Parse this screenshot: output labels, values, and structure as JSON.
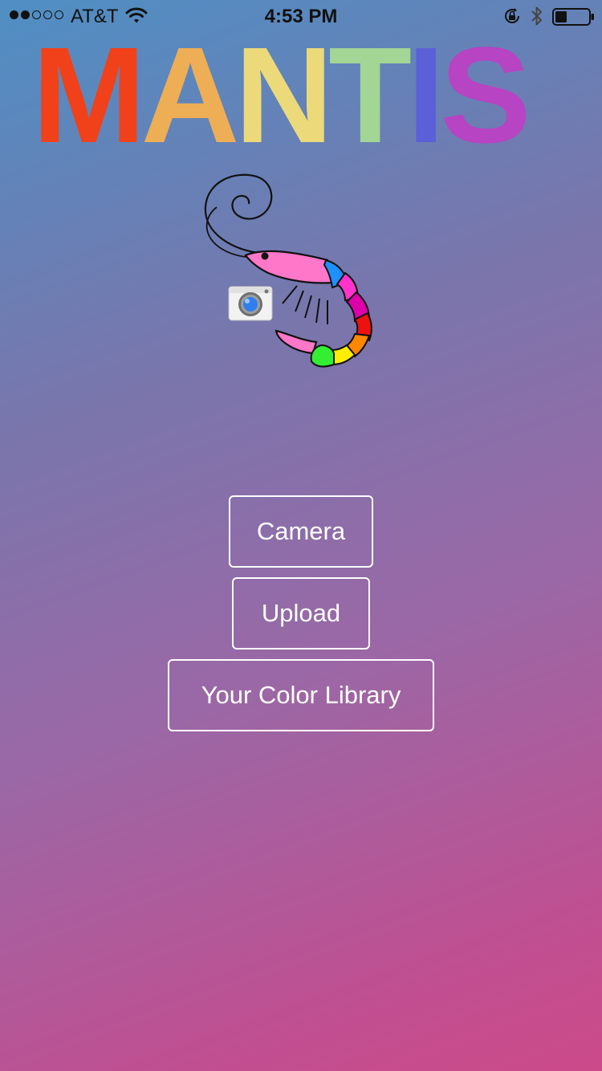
{
  "status_bar": {
    "signal_filled": 2,
    "signal_total": 5,
    "carrier": "AT&T",
    "time": "4:53 PM",
    "icons": [
      "wifi-icon",
      "orientation-lock-icon",
      "bluetooth-icon",
      "battery-icon"
    ],
    "battery_level": 0.35
  },
  "logo": {
    "letters": [
      {
        "char": "M",
        "color": "#f0411a"
      },
      {
        "char": "A",
        "color": "#eeae55"
      },
      {
        "char": "N",
        "color": "#ecd97a"
      },
      {
        "char": "T",
        "color": "#a3d595"
      },
      {
        "char": "I",
        "color": "#5b5fd8"
      },
      {
        "char": "S",
        "color": "#b744c2"
      }
    ]
  },
  "illustration": {
    "subject": "shrimp-icon",
    "badge": "camera-icon",
    "segment_colors": [
      "#1e90ff",
      "#ff33cc",
      "#dd00aa",
      "#ee1111",
      "#ff8800",
      "#ffee00",
      "#33ee33"
    ]
  },
  "buttons": {
    "camera": "Camera",
    "upload": "Upload",
    "library": "Your Color Library"
  }
}
